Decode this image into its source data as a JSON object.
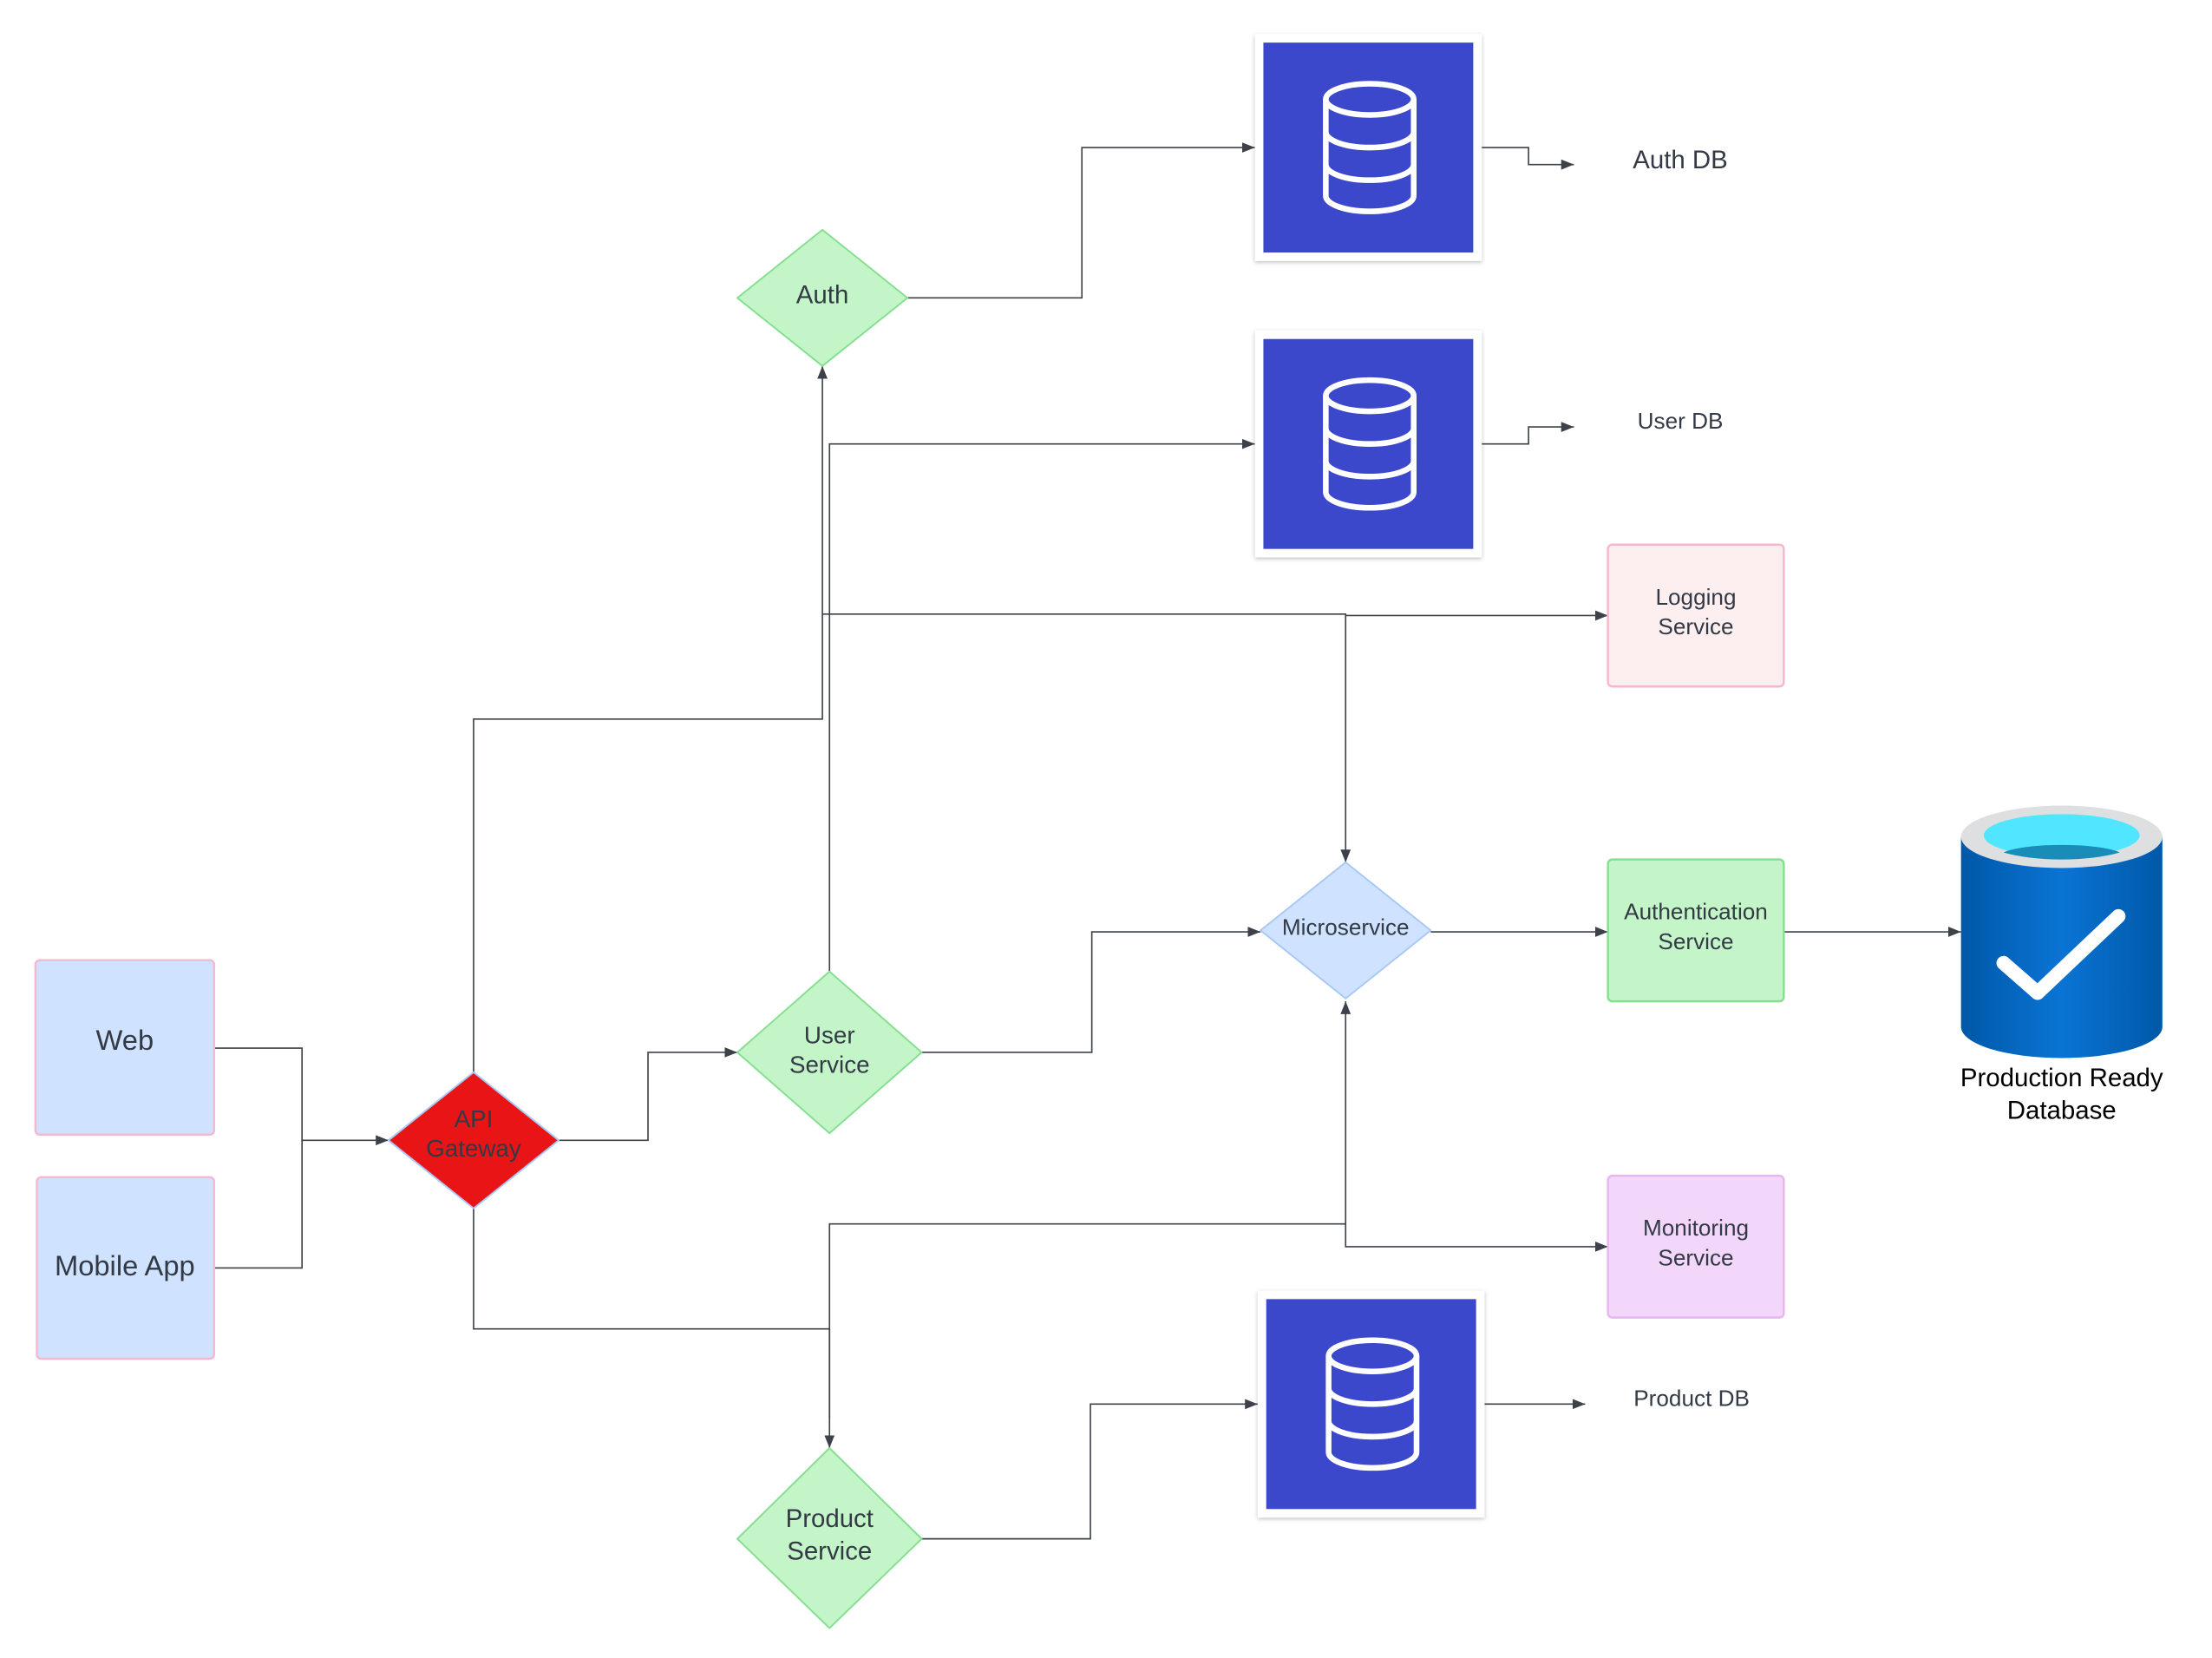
{
  "nodes": {
    "web": {
      "label": "Web"
    },
    "mobile_app": {
      "label": "Mobile App"
    },
    "api_gateway": {
      "line1": "API",
      "line2": "Gateway"
    },
    "auth": {
      "label": "Auth"
    },
    "user_service": {
      "line1": "User",
      "line2": "Service"
    },
    "product_service": {
      "line1": "Product",
      "line2": "Service"
    },
    "microservice": {
      "label": "Microservice"
    },
    "logging_service": {
      "line1": "Logging",
      "line2": "Service"
    },
    "authentication_service": {
      "line1": "Authentication",
      "line2": "Service"
    },
    "monitoring_service": {
      "line1": "Monitoring",
      "line2": "Service"
    },
    "production_db": {
      "line1": "Production Ready",
      "line2": "Database",
      "icon": "database-check-icon"
    },
    "auth_db": {
      "label": "Auth DB",
      "icon": "database-icon"
    },
    "user_db": {
      "label": "User DB",
      "icon": "database-icon"
    },
    "product_db": {
      "label": "Product DB",
      "icon": "database-icon"
    }
  },
  "colors": {
    "client_fill": "#cfe2ff",
    "client_stroke": "#f5b8d0",
    "gateway_fill": "#e81416",
    "service_fill": "#c3f5c8",
    "service_stroke": "#86df90",
    "microservice_fill": "#cfe2ff",
    "logging_fill": "#fdeff0",
    "monitoring_fill": "#f2d7fb",
    "db_tile": "#3c48cc",
    "edge": "#3d4149"
  }
}
